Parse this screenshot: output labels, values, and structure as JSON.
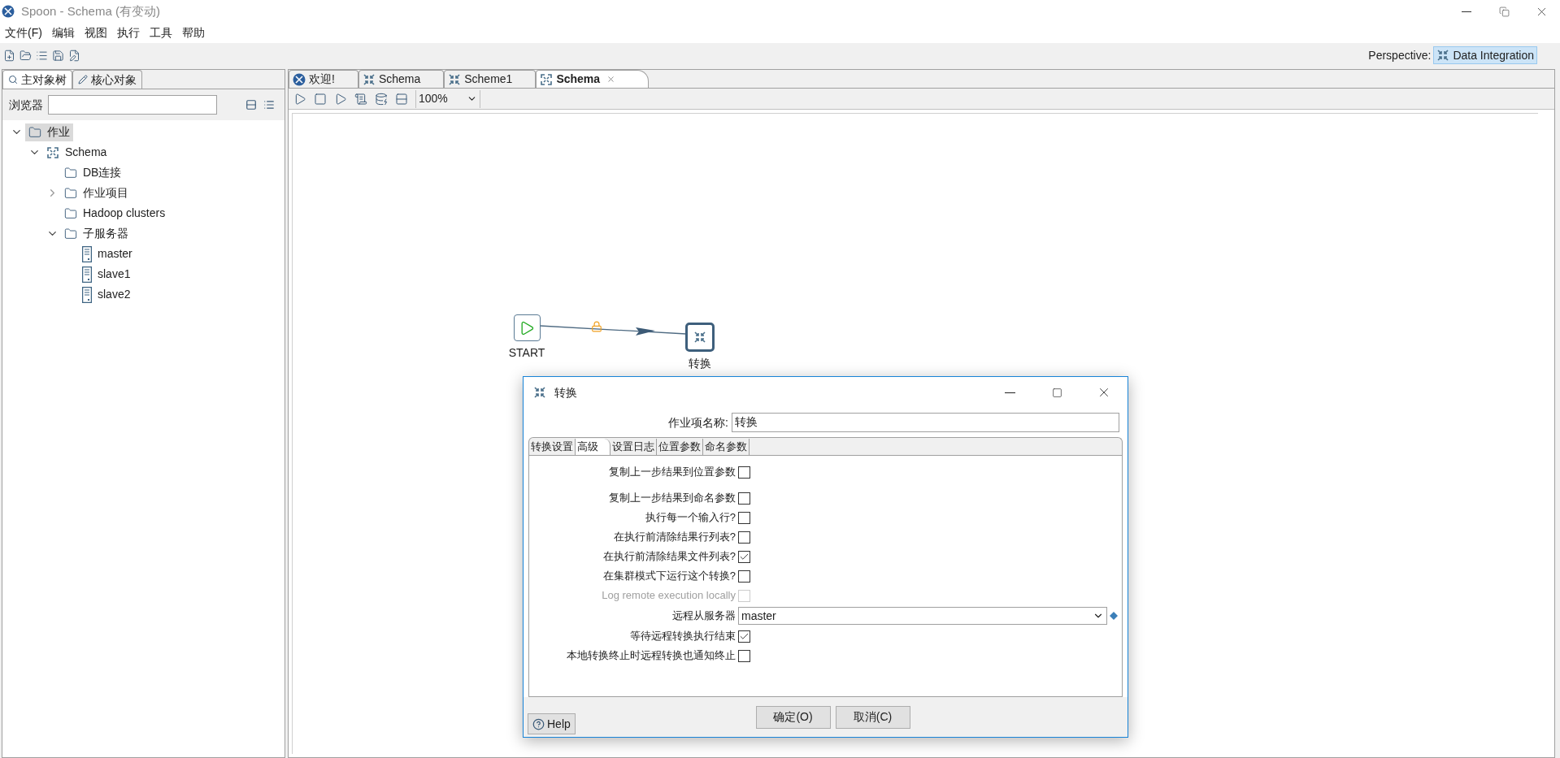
{
  "window": {
    "title": "Spoon - Schema (有变动)"
  },
  "menu": [
    "文件(F)",
    "编辑",
    "视图",
    "执行",
    "工具",
    "帮助"
  ],
  "perspective": {
    "label": "Perspective:",
    "value": "Data Integration"
  },
  "left_panel": {
    "tabs": [
      {
        "label": "主对象树",
        "selected": true
      },
      {
        "label": "核心对象",
        "selected": false
      }
    ],
    "search": {
      "label": "浏览器"
    },
    "tree": [
      {
        "label": "作业",
        "kind": "folder",
        "expanded": true,
        "selected": true,
        "children": [
          {
            "label": "Schema",
            "kind": "job",
            "expanded": true,
            "selected": false,
            "children": [
              {
                "label": "DB连接",
                "kind": "folder",
                "selected": false
              },
              {
                "label": "作业项目",
                "kind": "folder",
                "expanded": false,
                "selected": false
              },
              {
                "label": "Hadoop clusters",
                "kind": "folder",
                "selected": false
              },
              {
                "label": "子服务器",
                "kind": "folder",
                "expanded": true,
                "selected": false,
                "children": [
                  {
                    "label": "master",
                    "kind": "server",
                    "selected": false
                  },
                  {
                    "label": "slave1",
                    "kind": "server",
                    "selected": false
                  },
                  {
                    "label": "slave2",
                    "kind": "server",
                    "selected": false
                  }
                ]
              }
            ]
          }
        ]
      }
    ]
  },
  "editor": {
    "tabs": [
      {
        "label": "欢迎!",
        "kind": "welcome",
        "selected": false
      },
      {
        "label": "Schema",
        "kind": "transform",
        "selected": false
      },
      {
        "label": "Scheme1",
        "kind": "transform",
        "selected": false
      },
      {
        "label": "Schema",
        "kind": "job",
        "selected": true
      }
    ],
    "zoom": "100%",
    "canvas": {
      "nodes": [
        {
          "label": "START",
          "kind": "start"
        },
        {
          "label": "转换",
          "kind": "transform"
        }
      ]
    }
  },
  "dialog": {
    "title": "转换",
    "name_label": "作业项名称:",
    "name_value": "转换",
    "tabs": [
      {
        "label": "转换设置",
        "selected": false
      },
      {
        "label": "高级",
        "selected": true
      },
      {
        "label": "设置日志",
        "selected": false
      },
      {
        "label": "位置参数",
        "selected": false
      },
      {
        "label": "命名参数",
        "selected": false
      }
    ],
    "options": [
      {
        "kind": "checkbox",
        "label": "复制上一步结果到位置参数",
        "checked": false,
        "disabled": false
      },
      {
        "kind": "checkbox",
        "label": "复制上一步结果到命名参数",
        "checked": false,
        "disabled": false
      },
      {
        "kind": "checkbox",
        "label": "执行每一个输入行?",
        "checked": false,
        "disabled": false
      },
      {
        "kind": "checkbox",
        "label": "在执行前清除结果行列表?",
        "checked": false,
        "disabled": false
      },
      {
        "kind": "checkbox",
        "label": "在执行前清除结果文件列表?",
        "checked": true,
        "disabled": false
      },
      {
        "kind": "checkbox",
        "label": "在集群模式下运行这个转换?",
        "checked": false,
        "disabled": false
      },
      {
        "kind": "checkbox",
        "label": "Log remote execution locally",
        "checked": false,
        "disabled": true
      },
      {
        "kind": "select",
        "label": "远程从服务器",
        "value": "master"
      },
      {
        "kind": "checkbox",
        "label": "等待远程转换执行结束",
        "checked": true,
        "disabled": false
      },
      {
        "kind": "checkbox",
        "label": "本地转换终止时远程转换也通知终止",
        "checked": false,
        "disabled": false
      }
    ],
    "help": "Help",
    "buttons": [
      "确定(O)",
      "取消(C)"
    ]
  }
}
